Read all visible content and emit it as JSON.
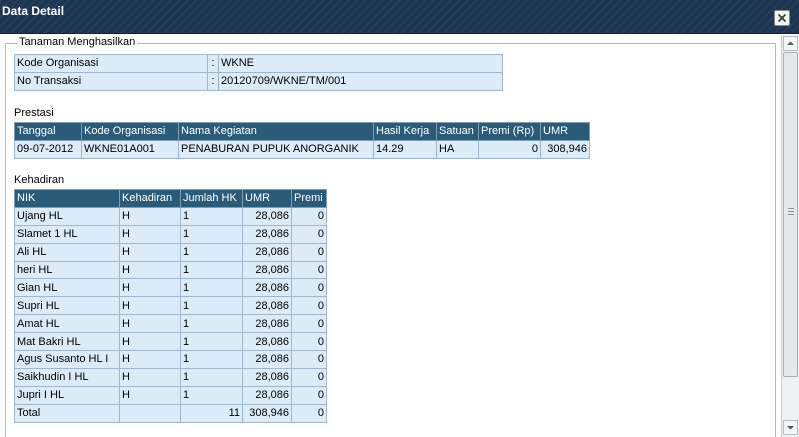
{
  "window": {
    "title": "Data Detail"
  },
  "fieldset": {
    "legend": "Tanaman Menghasilkan"
  },
  "info": [
    {
      "label": "Kode Organisasi",
      "sep": ":",
      "value": "WKNE"
    },
    {
      "label": "No Transaksi",
      "sep": ":",
      "value": "20120709/WKNE/TM/001"
    }
  ],
  "prestasi": {
    "heading": "Prestasi",
    "columns": [
      "Tanggal",
      "Kode Organisasi",
      "Nama Kegiatan",
      "Hasil Kerja",
      "Satuan",
      "Premi (Rp)",
      "UMR"
    ],
    "row": [
      "09-07-2012",
      "WKNE01A001",
      "PENABURAN PUPUK ANORGANIK",
      "14.29",
      "HA",
      "0",
      "308,946"
    ]
  },
  "kehadiran": {
    "heading": "Kehadiran",
    "columns": [
      "NIK",
      "Kehadiran",
      "Jumlah HK",
      "UMR",
      "Premi"
    ],
    "rows": [
      [
        "Ujang HL",
        "H",
        "1",
        "28,086",
        "0"
      ],
      [
        "Slamet 1 HL",
        "H",
        "1",
        "28,086",
        "0"
      ],
      [
        "Ali HL",
        "H",
        "1",
        "28,086",
        "0"
      ],
      [
        "heri HL",
        "H",
        "1",
        "28,086",
        "0"
      ],
      [
        "Gian HL",
        "H",
        "1",
        "28,086",
        "0"
      ],
      [
        "Supri HL",
        "H",
        "1",
        "28,086",
        "0"
      ],
      [
        "Amat HL",
        "H",
        "1",
        "28,086",
        "0"
      ],
      [
        "Mat Bakri HL",
        "H",
        "1",
        "28,086",
        "0"
      ],
      [
        "Agus Susanto HL I",
        "H",
        "1",
        "28,086",
        "0"
      ],
      [
        "Saikhudin I HL",
        "H",
        "1",
        "28,086",
        "0"
      ],
      [
        "Jupri I HL",
        "H",
        "1",
        "28,086",
        "0"
      ]
    ],
    "total": {
      "label": "Total",
      "jumlah_hk": "11",
      "umr": "308,946",
      "premi": "0"
    }
  }
}
